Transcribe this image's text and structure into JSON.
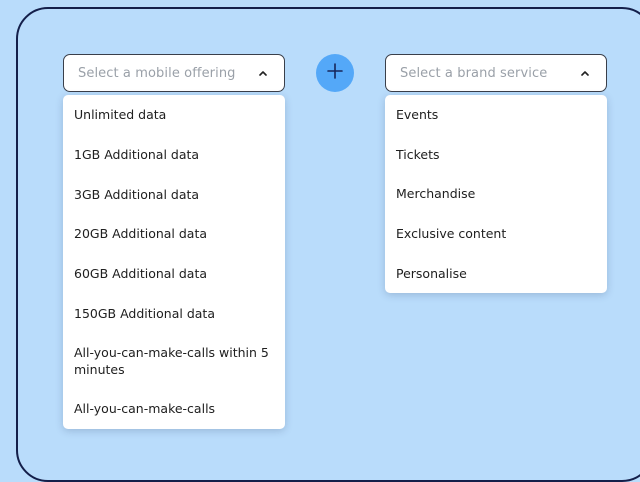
{
  "left_select": {
    "placeholder": "Select a mobile offering",
    "icon": "chevron-up-icon"
  },
  "add_button": {
    "icon": "plus-icon",
    "color": "#54a8f8"
  },
  "right_select": {
    "placeholder": "Select a brand service",
    "icon": "chevron-up-icon"
  },
  "mobile_offerings": [
    "Unlimited data",
    "1GB Additional data",
    "3GB Additional data",
    "20GB Additional data",
    "60GB Additional data",
    "150GB Additional data",
    "All-you-can-make-calls within 5 minutes",
    "All-you-can-make-calls"
  ],
  "brand_services": [
    "Events",
    "Tickets",
    "Merchandise",
    "Exclusive content",
    "Personalise"
  ],
  "colors": {
    "background": "#b9dcfb",
    "border": "#141f4a",
    "accent": "#54a8f8"
  }
}
